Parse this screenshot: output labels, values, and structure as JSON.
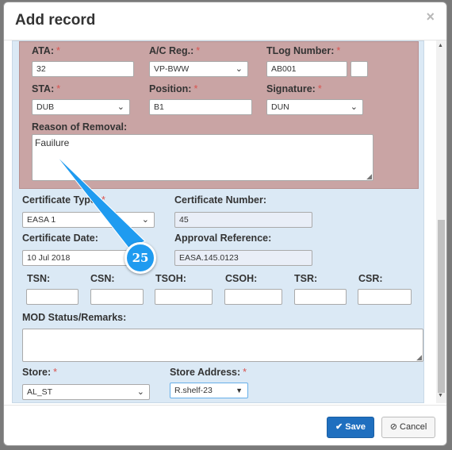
{
  "modal": {
    "title": "Add record",
    "close_glyph": "×"
  },
  "form": {
    "ata": {
      "label": "ATA:",
      "value": "32"
    },
    "ac_reg": {
      "label": "A/C Reg.:",
      "value": "VP-BWW"
    },
    "tlog_number": {
      "label": "TLog Number:",
      "value": "AB001",
      "extra_value": ""
    },
    "sta": {
      "label": "STA:",
      "value": "DUB"
    },
    "position": {
      "label": "Position:",
      "value": "B1"
    },
    "signature": {
      "label": "Signature:",
      "value": "DUN"
    },
    "reason_of_removal": {
      "label": "Reason of Removal:",
      "value": "Fauilure"
    },
    "certificate_type": {
      "label": "Certificate Type:",
      "value": "EASA 1"
    },
    "certificate_number": {
      "label": "Certificate Number:",
      "value": "45"
    },
    "certificate_date": {
      "label": "Certificate Date:",
      "value": "10 Jul 2018"
    },
    "approval_reference": {
      "label": "Approval Reference:",
      "value": "EASA.145.0123"
    },
    "tsn": {
      "label": "TSN:",
      "value": ""
    },
    "csn": {
      "label": "CSN:",
      "value": ""
    },
    "tsoh": {
      "label": "TSOH:",
      "value": ""
    },
    "csoh": {
      "label": "CSOH:",
      "value": ""
    },
    "tsr": {
      "label": "TSR:",
      "value": ""
    },
    "csr": {
      "label": "CSR:",
      "value": ""
    },
    "mod_status": {
      "label": "MOD Status/Remarks:",
      "value": ""
    },
    "store": {
      "label": "Store:",
      "value": "AL_ST"
    },
    "store_address": {
      "label": "Store Address:",
      "value": "R.shelf-23"
    },
    "required_mark": "*"
  },
  "footer": {
    "save_label": "Save",
    "cancel_label": "Cancel"
  },
  "annotation": {
    "badge_number": "25",
    "badge_color": "#1f9bf0"
  },
  "colors": {
    "primary": "#1f6fbf",
    "required": "#d9534f",
    "highlight_section": "#c9a4a4",
    "form_background": "#dbe9f5"
  }
}
